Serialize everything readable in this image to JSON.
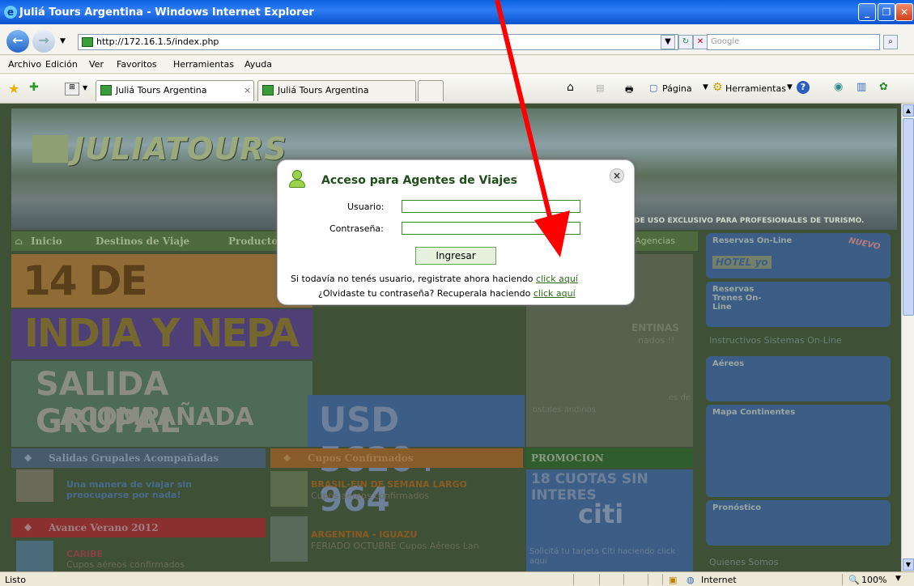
{
  "window": {
    "title": "Juliá Tours Argentina - Windows Internet Explorer"
  },
  "address": {
    "url": "http://172.16.1.5/index.php",
    "search_placeholder": "Google"
  },
  "menu": [
    "Archivo",
    "Edición",
    "Ver",
    "Favoritos",
    "Herramientas",
    "Ayuda"
  ],
  "tabs": [
    {
      "label": "Juliá Tours Argentina",
      "close": "×"
    },
    {
      "label": "Juliá Tours Argentina"
    }
  ],
  "toolbar": {
    "page": "Página",
    "tools": "Herramientas"
  },
  "site": {
    "logo": "JULIATOURS",
    "exclusive": "ESTE WEB SITE ES DE USO EXCLUSIVO PARA PROFESIONALES DE TURISMO.",
    "nav": [
      "Inicio",
      "Destinos de Viaje",
      "Productos Especiales",
      "Acceso Agencias"
    ],
    "banner": {
      "line1": "14 DE NOVIEM",
      "line2": "INDIA Y NEPA",
      "line3": "SALIDA GRUPAL",
      "line4": "ACOMPAÑADA",
      "price": "USD 5620+ 964"
    },
    "mid": {
      "a": "ENTINAS",
      "b": "nados !!",
      "c": "es de",
      "d": "ostales andinos"
    },
    "sections": {
      "grupales": "Salidas Grupales Acompañadas",
      "grupales_text": "Una manera de viajar sin preocuparse por nada!",
      "cupos": "Cupos Confirmados",
      "brasil_title": "BRASIL-FIN DE SEMANA LARGO",
      "brasil_text": "Cupos aereos confirmados",
      "promocion": "PROMOCION",
      "cuotas": "18 CUOTAS SIN INTERES",
      "citi": "citi",
      "citi_text": "Solicitá tu tarjeta Citi haciendo click aquí",
      "verano": "Avance Verano 2012",
      "argentina_title": "ARGENTINA - IGUAZU",
      "argentina_text": "FERIADO OCTUBRE Cupos Aéreos Lan",
      "caribe_title": "CARIBE",
      "caribe_text": "Cupos aéreos confirmados"
    },
    "right": {
      "reservas_online": "Reservas On-Line",
      "nuevo": "NUEVO",
      "hotel": "HOTEL yo",
      "trenes": "Reservas Trenes On-Line",
      "instructivos": "Instructivos Sistemas On-Line",
      "aereos": "Aéreos",
      "mapa": "Mapa Continentes",
      "pronostico": "Pronóstico",
      "quienes": "Quienes Somos"
    }
  },
  "modal": {
    "title": "Acceso para Agentes de Viajes",
    "user_label": "Usuario:",
    "pass_label": "Contraseña:",
    "submit": "Ingresar",
    "register_text": "Si todavía no tenés usuario, registrate ahora haciendo ",
    "register_link": "click aquí",
    "forgot_text": "¿Olvidaste tu contraseña? Recuperala haciendo ",
    "forgot_link": "click aquí",
    "close": "×"
  },
  "status": {
    "left": "Listo",
    "zone": "Internet",
    "zoom": "100%"
  },
  "colors": {
    "arrow": "#ff0000",
    "title_bar": "#0a5fe0",
    "site_green": "#3e5136"
  }
}
